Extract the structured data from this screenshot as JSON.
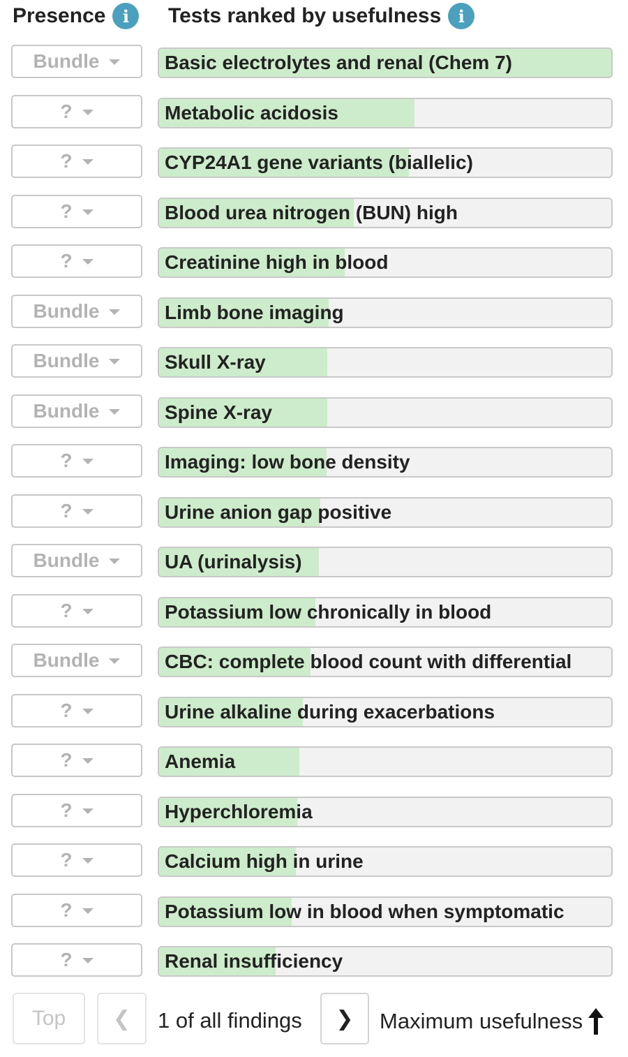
{
  "header": {
    "presence_title": "Presence",
    "ranked_title": "Tests ranked by usefulness",
    "info_glyph": "i"
  },
  "tests": [
    {
      "presence": "Bundle",
      "label": "Basic electrolytes and renal (Chem 7)",
      "usefulness": 1.0
    },
    {
      "presence": "?",
      "label": "Metabolic acidosis",
      "usefulness": 0.565
    },
    {
      "presence": "?",
      "label": "CYP24A1 gene variants (biallelic)",
      "usefulness": 0.553
    },
    {
      "presence": "?",
      "label": "Blood urea nitrogen (BUN) high",
      "usefulness": 0.43
    },
    {
      "presence": "?",
      "label": "Creatinine high in blood",
      "usefulness": 0.41
    },
    {
      "presence": "Bundle",
      "label": "Limb bone imaging",
      "usefulness": 0.375
    },
    {
      "presence": "Bundle",
      "label": "Skull X-ray",
      "usefulness": 0.372
    },
    {
      "presence": "Bundle",
      "label": "Spine X-ray",
      "usefulness": 0.372
    },
    {
      "presence": "?",
      "label": "Imaging: low bone density",
      "usefulness": 0.37
    },
    {
      "presence": "?",
      "label": "Urine anion gap positive",
      "usefulness": 0.356
    },
    {
      "presence": "Bundle",
      "label": "UA (urinalysis)",
      "usefulness": 0.354
    },
    {
      "presence": "?",
      "label": "Potassium low chronically in blood",
      "usefulness": 0.346
    },
    {
      "presence": "Bundle",
      "label": "CBC: complete blood count with differential",
      "usefulness": 0.335
    },
    {
      "presence": "?",
      "label": "Urine alkaline during exacerbations",
      "usefulness": 0.318
    },
    {
      "presence": "?",
      "label": "Anemia",
      "usefulness": 0.31
    },
    {
      "presence": "?",
      "label": "Hyperchloremia",
      "usefulness": 0.305
    },
    {
      "presence": "?",
      "label": "Calcium high in urine",
      "usefulness": 0.303
    },
    {
      "presence": "?",
      "label": "Potassium low in blood when symptomatic",
      "usefulness": 0.293
    },
    {
      "presence": "?",
      "label": "Renal insufficiency",
      "usefulness": 0.258
    }
  ],
  "footer": {
    "top_label": "Top",
    "prev_glyph": "❮",
    "page_status": "1 of all findings",
    "next_glyph": "❯",
    "sort_label": "Maximum usefulness"
  },
  "icons": {
    "info": "info-icon",
    "dropdown": "caret-down-icon",
    "sort": "arrow-up-icon"
  },
  "colors": {
    "info_blue": "#4aa0bd",
    "usefulness_fill": "#cdeccb",
    "bar_background": "#f2f2f2",
    "muted_text": "#b3b3b3"
  }
}
